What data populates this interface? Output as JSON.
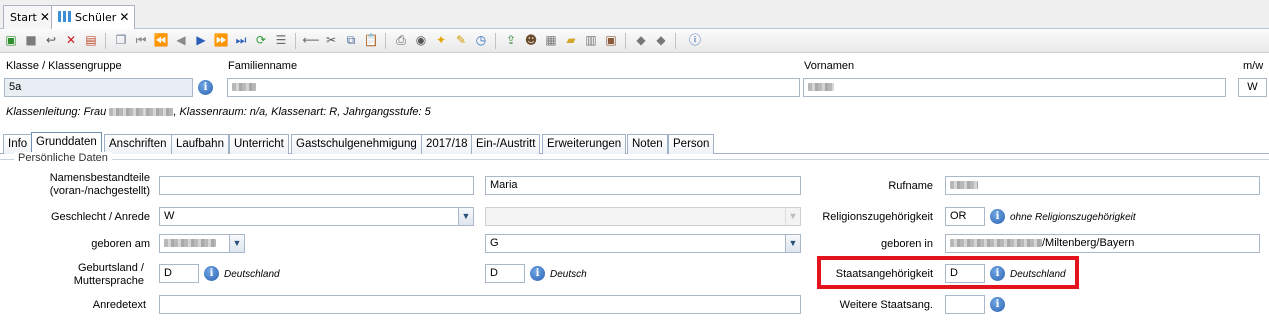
{
  "doc_tabs": [
    {
      "label": "Start",
      "close": "✕"
    },
    {
      "label": "Schüler",
      "close": "✕"
    }
  ],
  "toolbar": {
    "icons": [
      "new-record-icon",
      "save-icon",
      "undo-icon",
      "delete-icon",
      "form-icon",
      "copy-icon",
      "first-record-icon",
      "prev-page-icon",
      "prev-record-icon",
      "next-record-icon",
      "next-page-icon",
      "last-record-icon",
      "refresh-icon",
      "list-icon",
      "back-arrow-icon",
      "cut-icon",
      "copy-doc-icon",
      "paste-icon",
      "print-icon",
      "preview-icon",
      "idea-icon",
      "clean-icon",
      "clock-icon",
      "export-icon",
      "person-icon",
      "pattern-icon",
      "folder-icon",
      "book-icon",
      "id-card-icon",
      "arrow-left-icon",
      "arrow-right-icon",
      "help-icon"
    ]
  },
  "header": {
    "klasse_label": "Klasse / Klassengruppe",
    "klasse_value": "5a",
    "info": "i",
    "familienname_label": "Familienname",
    "vornamen_label": "Vornamen",
    "mw_label": "m/w",
    "mw_value": "W",
    "klassenleitung_prefix": "Klassenleitung: Frau",
    "klassenleitung_suffix": ", Klassenraum: n/a, Klassenart: R, Jahrgangsstufe: 5"
  },
  "tabs": [
    "Info",
    "Grunddaten",
    "Anschriften",
    "Laufbahn",
    "Unterricht",
    "Gastschulgenehmigung",
    "2017/18",
    "Ein-/Austritt",
    "Erweiterungen",
    "Noten",
    "Person"
  ],
  "active_tab": "Grunddaten",
  "section_title": "Persönliche Daten",
  "form": {
    "namensbestandteile_label": "Namensbestandteile (voran-/nachgestellt)",
    "second_name": "Maria",
    "rufname_label": "Rufname",
    "geschlecht_label": "Geschlecht / Anrede",
    "geschlecht_value": "W",
    "religion_label": "Religionszugehörigkeit",
    "religion_value": "OR",
    "religion_hint": "ohne Religionszugehörigkeit",
    "geboren_am_label": "geboren am",
    "g_value": "G",
    "geboren_in_label": "geboren in",
    "geboren_in_suffix": "/Miltenberg/Bayern",
    "geburtsland_label": "Geburtsland / Muttersprache",
    "geburtsland_value": "D",
    "geburtsland_hint": "Deutschland",
    "sprache_value": "D",
    "sprache_hint": "Deutsch",
    "staats_label": "Staatsangehörigkeit",
    "staats_value": "D",
    "staats_hint": "Deutschland",
    "anredetext_label": "Anredetext",
    "weitere_label": "Weitere Staatsang."
  },
  "colors": {
    "highlight": "#e3131b",
    "accent": "#2c62b0"
  }
}
